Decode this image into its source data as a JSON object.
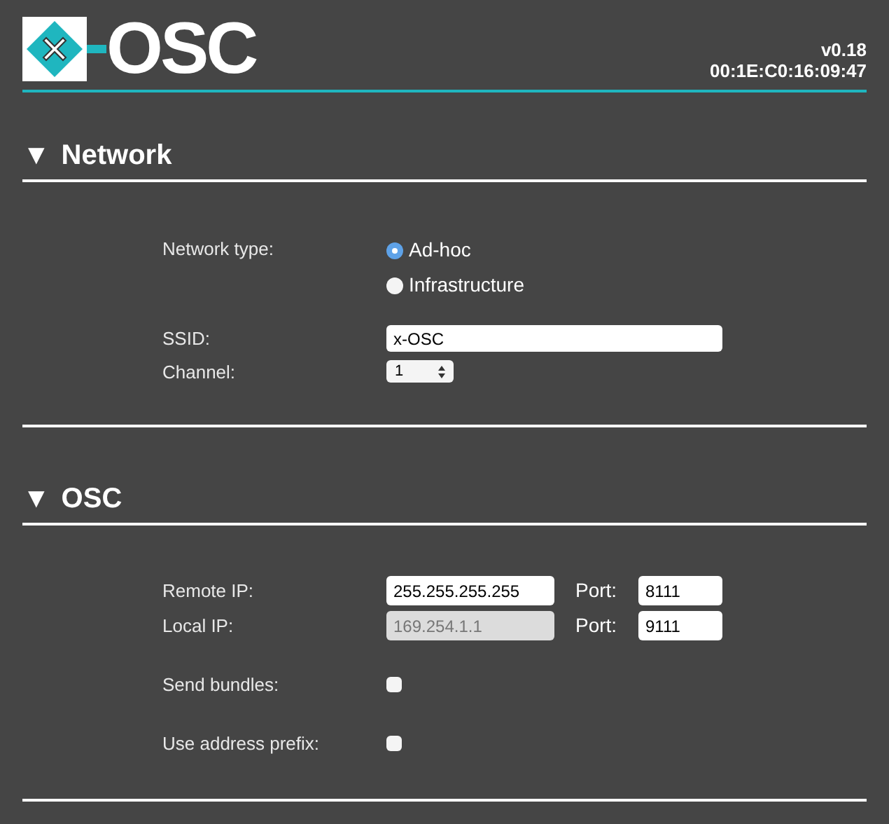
{
  "header": {
    "logo_text": "OSC",
    "version": "v0.18",
    "mac_address": "00:1E:C0:16:09:47"
  },
  "sections": [
    {
      "toggle": "▼",
      "title": "Network",
      "expanded": true,
      "groups": [
        [
          {
            "kind": "radio",
            "label": "Network type:",
            "options": [
              {
                "label": "Ad-hoc",
                "selected": true
              },
              {
                "label": "Infrastructure",
                "selected": false
              }
            ]
          }
        ],
        [
          {
            "kind": "text",
            "label": "SSID:",
            "value": "x-OSC"
          },
          {
            "kind": "select",
            "label": "Channel:",
            "value": "1"
          }
        ]
      ]
    },
    {
      "toggle": "▼",
      "title": "OSC",
      "expanded": true,
      "groups": [
        [
          {
            "kind": "address",
            "label": "Remote IP:",
            "value": "255.255.255.255",
            "disabled": false,
            "port_label": "Port:",
            "port_value": "8111"
          },
          {
            "kind": "address",
            "label": "Local IP:",
            "value": "169.254.1.1",
            "disabled": true,
            "port_label": "Port:",
            "port_value": "9111"
          }
        ],
        [
          {
            "kind": "checkbox",
            "label": "Send bundles:",
            "checked": false
          }
        ],
        [
          {
            "kind": "checkbox",
            "label": "Use address prefix:",
            "checked": false
          }
        ]
      ]
    }
  ]
}
